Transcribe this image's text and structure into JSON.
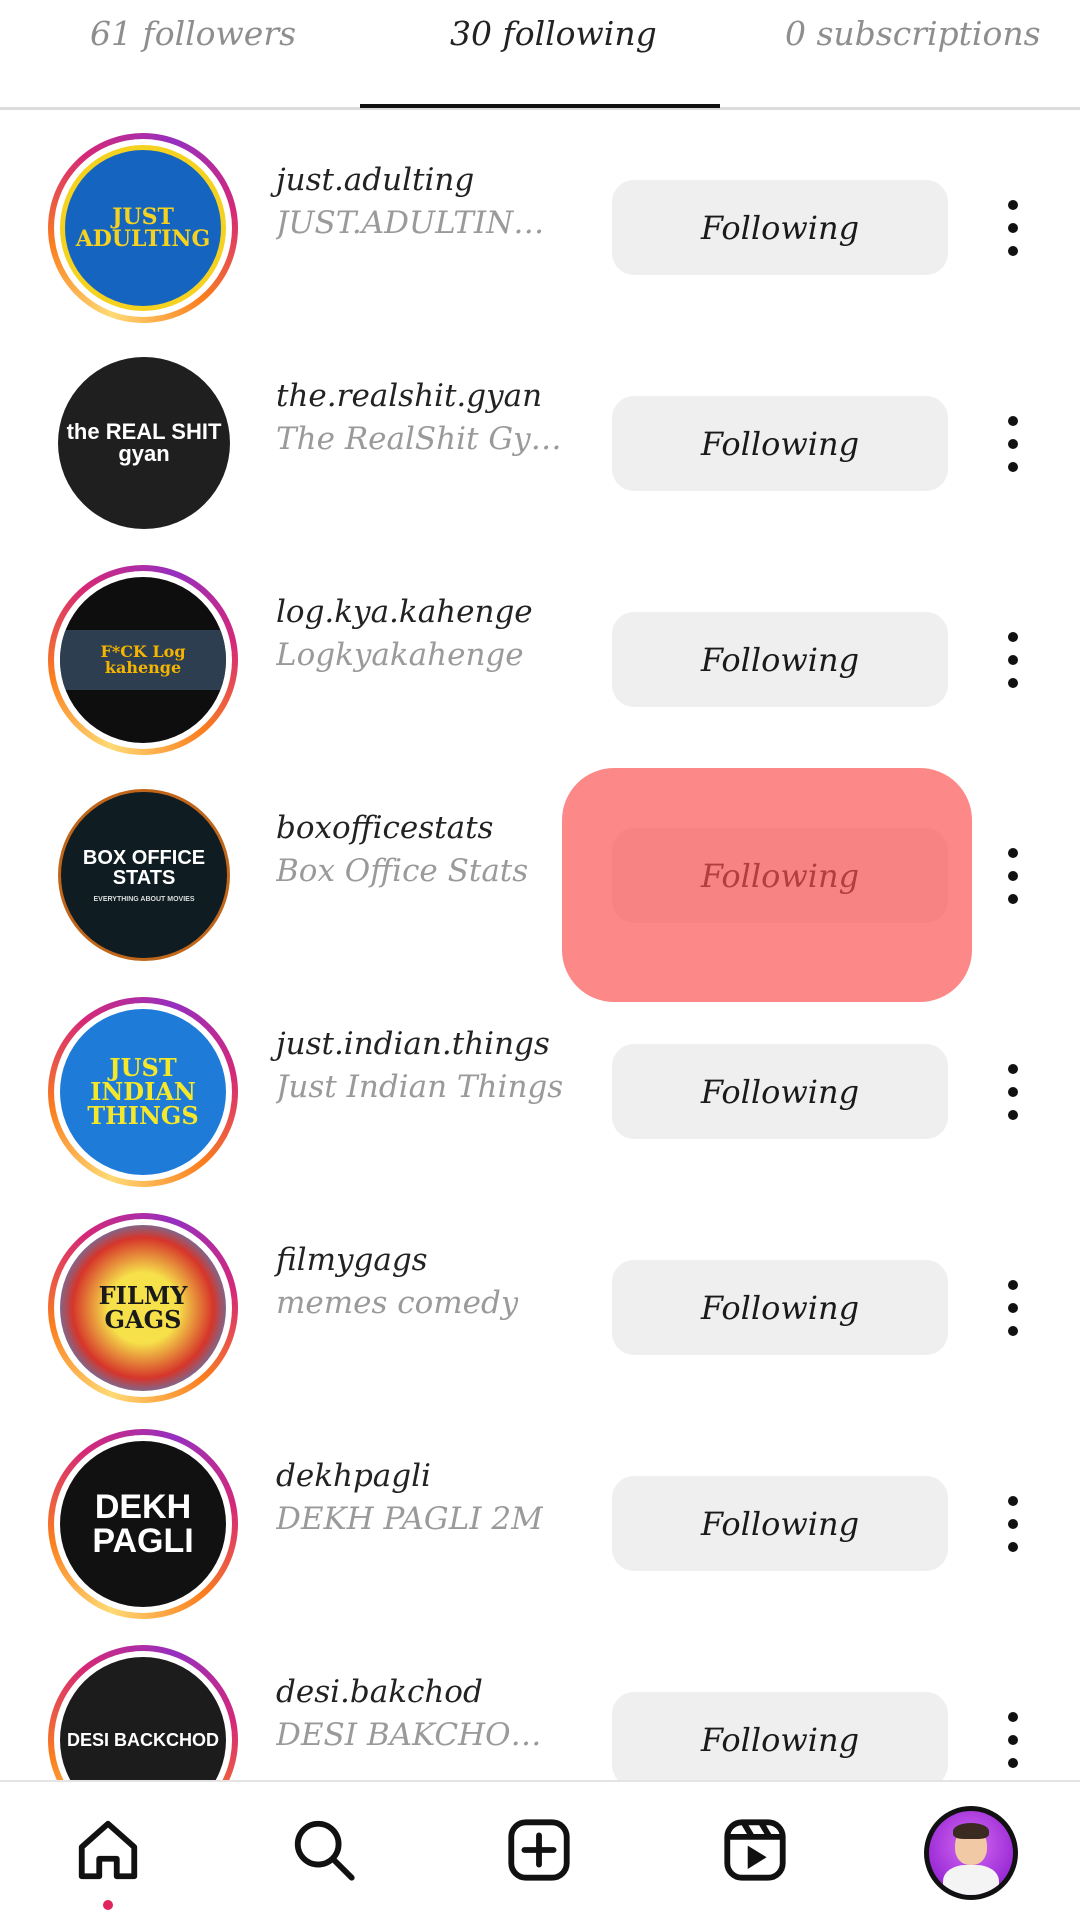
{
  "tabs": [
    {
      "label": "61 followers",
      "active": false
    },
    {
      "label": "30 following",
      "active": true
    },
    {
      "label": "0 subscriptions",
      "active": false
    }
  ],
  "button_label": "Following",
  "accounts": [
    {
      "username": "just.adulting",
      "full_name": "JUST.ADULTING 2...",
      "avatar_text": "JUST ADULTING",
      "story_ring": true
    },
    {
      "username": "the.realshit.gyan",
      "full_name": "The RealShit Gyan",
      "avatar_text": "the REAL SHIT gyan",
      "story_ring": false
    },
    {
      "username": "log.kya.kahenge",
      "full_name": "Logkyakahenge",
      "avatar_text": "F*CK Log kahenge",
      "story_ring": true
    },
    {
      "username": "boxofficestats",
      "full_name": "Box Office Stats",
      "avatar_text": "BOX OFFICE STATS",
      "avatar_subtext": "EVERYTHING ABOUT MOVIES",
      "story_ring": false
    },
    {
      "username": "just.indian.things",
      "full_name": "Just Indian Things",
      "avatar_text": "JUST INDIAN THINGS",
      "story_ring": true
    },
    {
      "username": "filmygags",
      "full_name": "memes comedy",
      "avatar_text": "FILMY GAGS",
      "story_ring": true
    },
    {
      "username": "dekhpagli",
      "full_name": "DEKH PAGLI 2M",
      "avatar_text": "DEKH PAGLI",
      "story_ring": true
    },
    {
      "username": "desi.bakchod",
      "full_name": "DESI BAKCHOD ®",
      "avatar_text": "DESI BACKCHOD",
      "story_ring": true
    }
  ],
  "nav": {
    "items": [
      "home-icon",
      "search-icon",
      "create-icon",
      "reels-icon",
      "profile-avatar"
    ],
    "active": "home-icon",
    "notification_dot_color": "#e0245e"
  },
  "colors": {
    "highlight": "#fa5050",
    "button_bg": "#efefef",
    "secondary_text": "#9a9a9a"
  }
}
